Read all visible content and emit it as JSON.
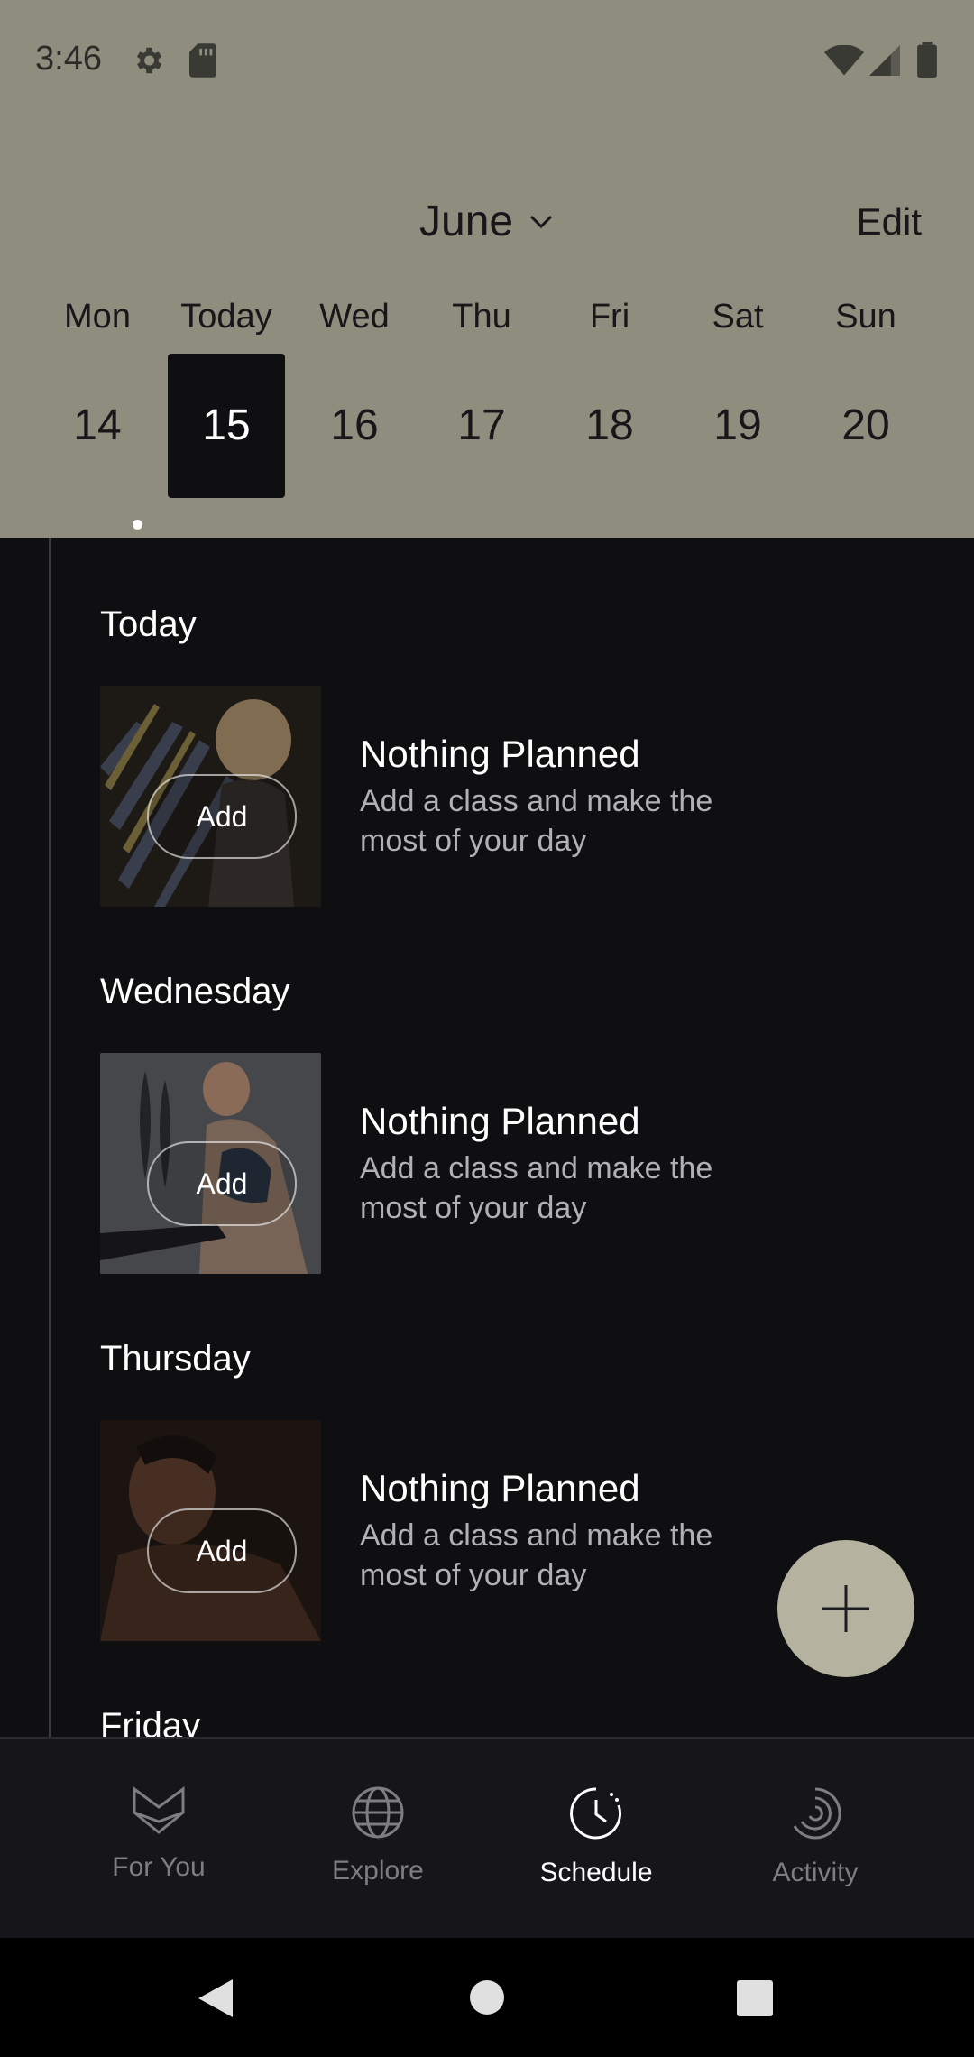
{
  "status_bar": {
    "time": "3:46"
  },
  "header": {
    "month": "June",
    "edit_label": "Edit"
  },
  "week": {
    "days": [
      {
        "name": "Mon",
        "num": "14"
      },
      {
        "name": "Today",
        "num": "15"
      },
      {
        "name": "Wed",
        "num": "16"
      },
      {
        "name": "Thu",
        "num": "17"
      },
      {
        "name": "Fri",
        "num": "18"
      },
      {
        "name": "Sat",
        "num": "19"
      },
      {
        "name": "Sun",
        "num": "20"
      }
    ],
    "selected_index": 1
  },
  "sections": [
    {
      "title": "Today",
      "card_title": "Nothing Planned",
      "desc": "Add a class and make the most of your day",
      "add_label": "Add"
    },
    {
      "title": "Wednesday",
      "card_title": "Nothing Planned",
      "desc": "Add a class and make the most of your day",
      "add_label": "Add"
    },
    {
      "title": "Thursday",
      "card_title": "Nothing Planned",
      "desc": "Add a class and make the most of your day",
      "add_label": "Add"
    },
    {
      "title": "Friday"
    }
  ],
  "bottom_nav": [
    {
      "label": "For You",
      "icon": "heart-check-icon"
    },
    {
      "label": "Explore",
      "icon": "globe-icon"
    },
    {
      "label": "Schedule",
      "icon": "clock-icon",
      "active": true
    },
    {
      "label": "Activity",
      "icon": "activity-rings-icon"
    }
  ],
  "colors": {
    "header_bg": "#8f8d7d",
    "content_bg": "#0f0f11",
    "fab": "#b5b2a0"
  }
}
